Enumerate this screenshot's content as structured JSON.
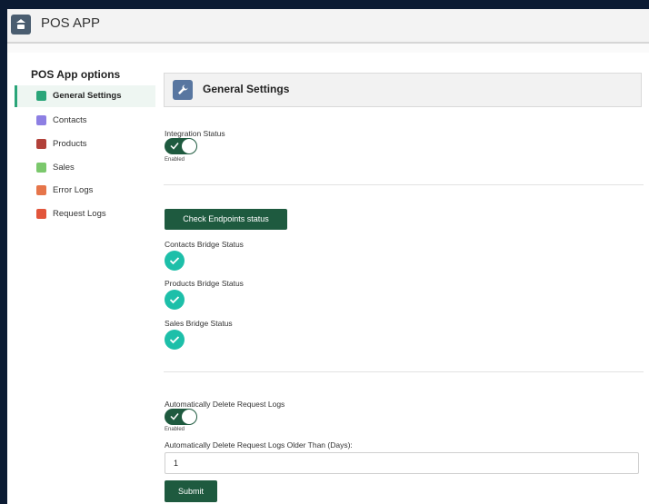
{
  "app": {
    "title": "POS APP"
  },
  "sidebar": {
    "title": "POS App options",
    "items": [
      {
        "label": "General Settings",
        "icon": "wrench-icon",
        "color": "#2aa579",
        "active": true
      },
      {
        "label": "Contacts",
        "icon": "contact-icon",
        "color": "#8d7fe3"
      },
      {
        "label": "Products",
        "icon": "product-icon",
        "color": "#b2413a"
      },
      {
        "label": "Sales",
        "icon": "sales-icon",
        "color": "#7bc86c"
      },
      {
        "label": "Error Logs",
        "icon": "error-log-icon",
        "color": "#e6754a"
      },
      {
        "label": "Request Logs",
        "icon": "request-log-icon",
        "color": "#e2553b"
      }
    ]
  },
  "main": {
    "header_title": "General Settings",
    "integration": {
      "label": "Integration Status",
      "state_label": "Enabled",
      "on": true
    },
    "check_button": "Check Endpoints status",
    "bridges": [
      {
        "label": "Contacts Bridge Status",
        "ok": true
      },
      {
        "label": "Products Bridge Status",
        "ok": true
      },
      {
        "label": "Sales Bridge Status",
        "ok": true
      }
    ],
    "auto_delete": {
      "label": "Automatically Delete Request Logs",
      "state_label": "Enabled",
      "on": true
    },
    "older_than": {
      "label": "Automatically Delete Request Logs Older Than (Days):",
      "value": "1"
    },
    "submit": "Submit"
  },
  "colors": {
    "primary": "#1e5a3f",
    "accent": "#2aa579",
    "success": "#1dbfa9"
  }
}
